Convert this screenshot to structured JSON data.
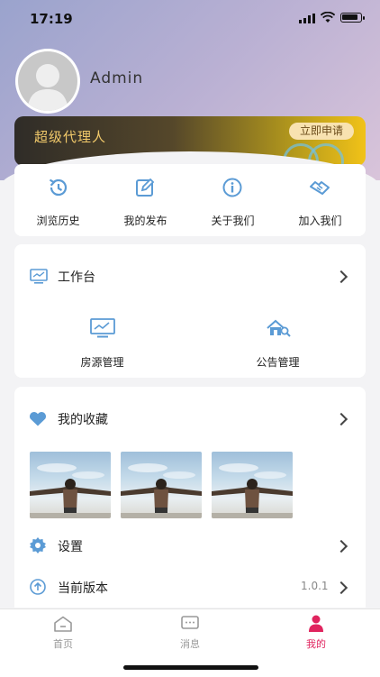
{
  "status_bar": {
    "time": "17:19"
  },
  "profile": {
    "username": "Admin"
  },
  "vip_banner": {
    "label": "超级代理人",
    "apply_button": "立即申请"
  },
  "quick_actions": [
    {
      "label": "浏览历史",
      "icon": "history-icon"
    },
    {
      "label": "我的发布",
      "icon": "edit-icon"
    },
    {
      "label": "关于我们",
      "icon": "info-icon"
    },
    {
      "label": "加入我们",
      "icon": "handshake-icon"
    }
  ],
  "workbench": {
    "title": "工作台",
    "items": [
      {
        "label": "房源管理",
        "icon": "monitor-chart-icon"
      },
      {
        "label": "公告管理",
        "icon": "house-search-icon"
      }
    ]
  },
  "favorites": {
    "title": "我的收藏"
  },
  "settings": {
    "label": "设置"
  },
  "version": {
    "label": "当前版本",
    "value": "1.0.1"
  },
  "tabbar": {
    "tabs": [
      {
        "label": "首页",
        "active": false
      },
      {
        "label": "消息",
        "active": false
      },
      {
        "label": "我的",
        "active": true
      }
    ]
  },
  "colors": {
    "accent": "#e0245e",
    "icon_blue": "#5b9bd5",
    "gold": "#f1c96a"
  }
}
